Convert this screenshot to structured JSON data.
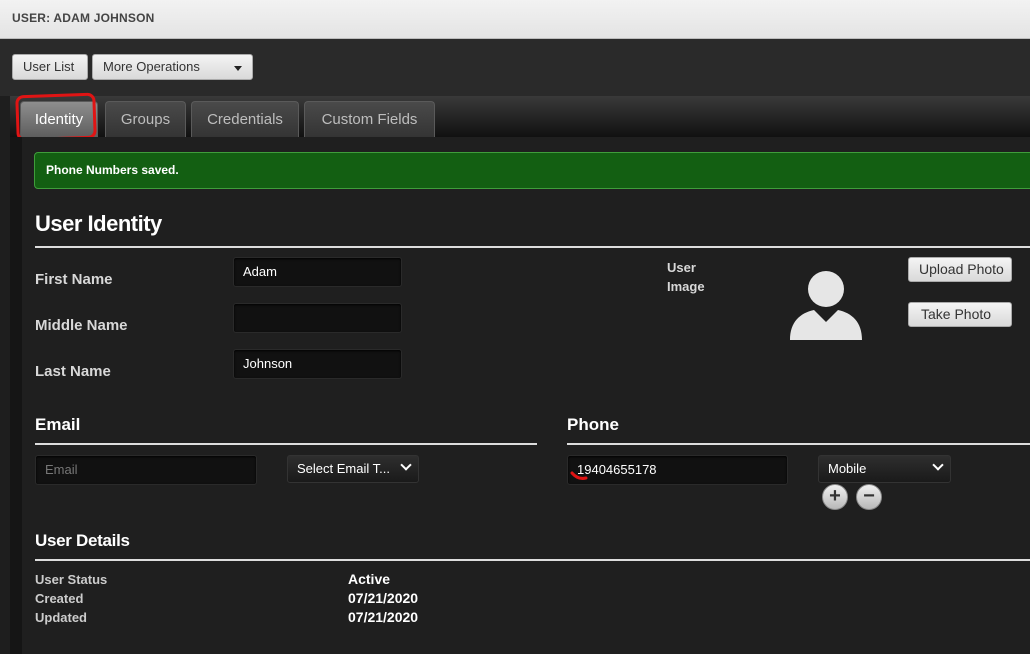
{
  "header": {
    "title": "USER: ADAM JOHNSON"
  },
  "toolbar": {
    "user_list_label": "User List",
    "more_operations_label": "More Operations"
  },
  "tabs": [
    {
      "label": "Identity",
      "active": true
    },
    {
      "label": "Groups"
    },
    {
      "label": "Credentials"
    },
    {
      "label": "Custom Fields"
    }
  ],
  "alert": {
    "message": "Phone Numbers saved."
  },
  "identity": {
    "heading": "User Identity",
    "first_name_label": "First Name",
    "first_name_value": "Adam",
    "middle_name_label": "Middle Name",
    "middle_name_value": "",
    "last_name_label": "Last Name",
    "last_name_value": "Johnson",
    "user_image_label": "User Image",
    "user_image_line1": "User",
    "user_image_line2": "Image",
    "upload_photo_label": "Upload Photo",
    "take_photo_label": "Take Photo"
  },
  "email": {
    "heading": "Email",
    "placeholder": "Email",
    "type_select": "Select Email T..."
  },
  "phone": {
    "heading": "Phone",
    "number": "19404655178",
    "type_select": "Mobile",
    "add_symbol": "+",
    "remove_symbol": "−"
  },
  "details": {
    "heading": "User Details",
    "status_label": "User Status",
    "status_value": "Active",
    "created_label": "Created",
    "created_value": "07/21/2020",
    "updated_label": "Updated",
    "updated_value": "07/21/2020"
  },
  "colors": {
    "alert_bg": "#135f12",
    "annotation": "#e01414"
  },
  "icons": {
    "avatar": "user-silhouette-icon",
    "dropdown": "chevron-down-icon",
    "add": "plus-icon",
    "remove": "minus-icon"
  }
}
